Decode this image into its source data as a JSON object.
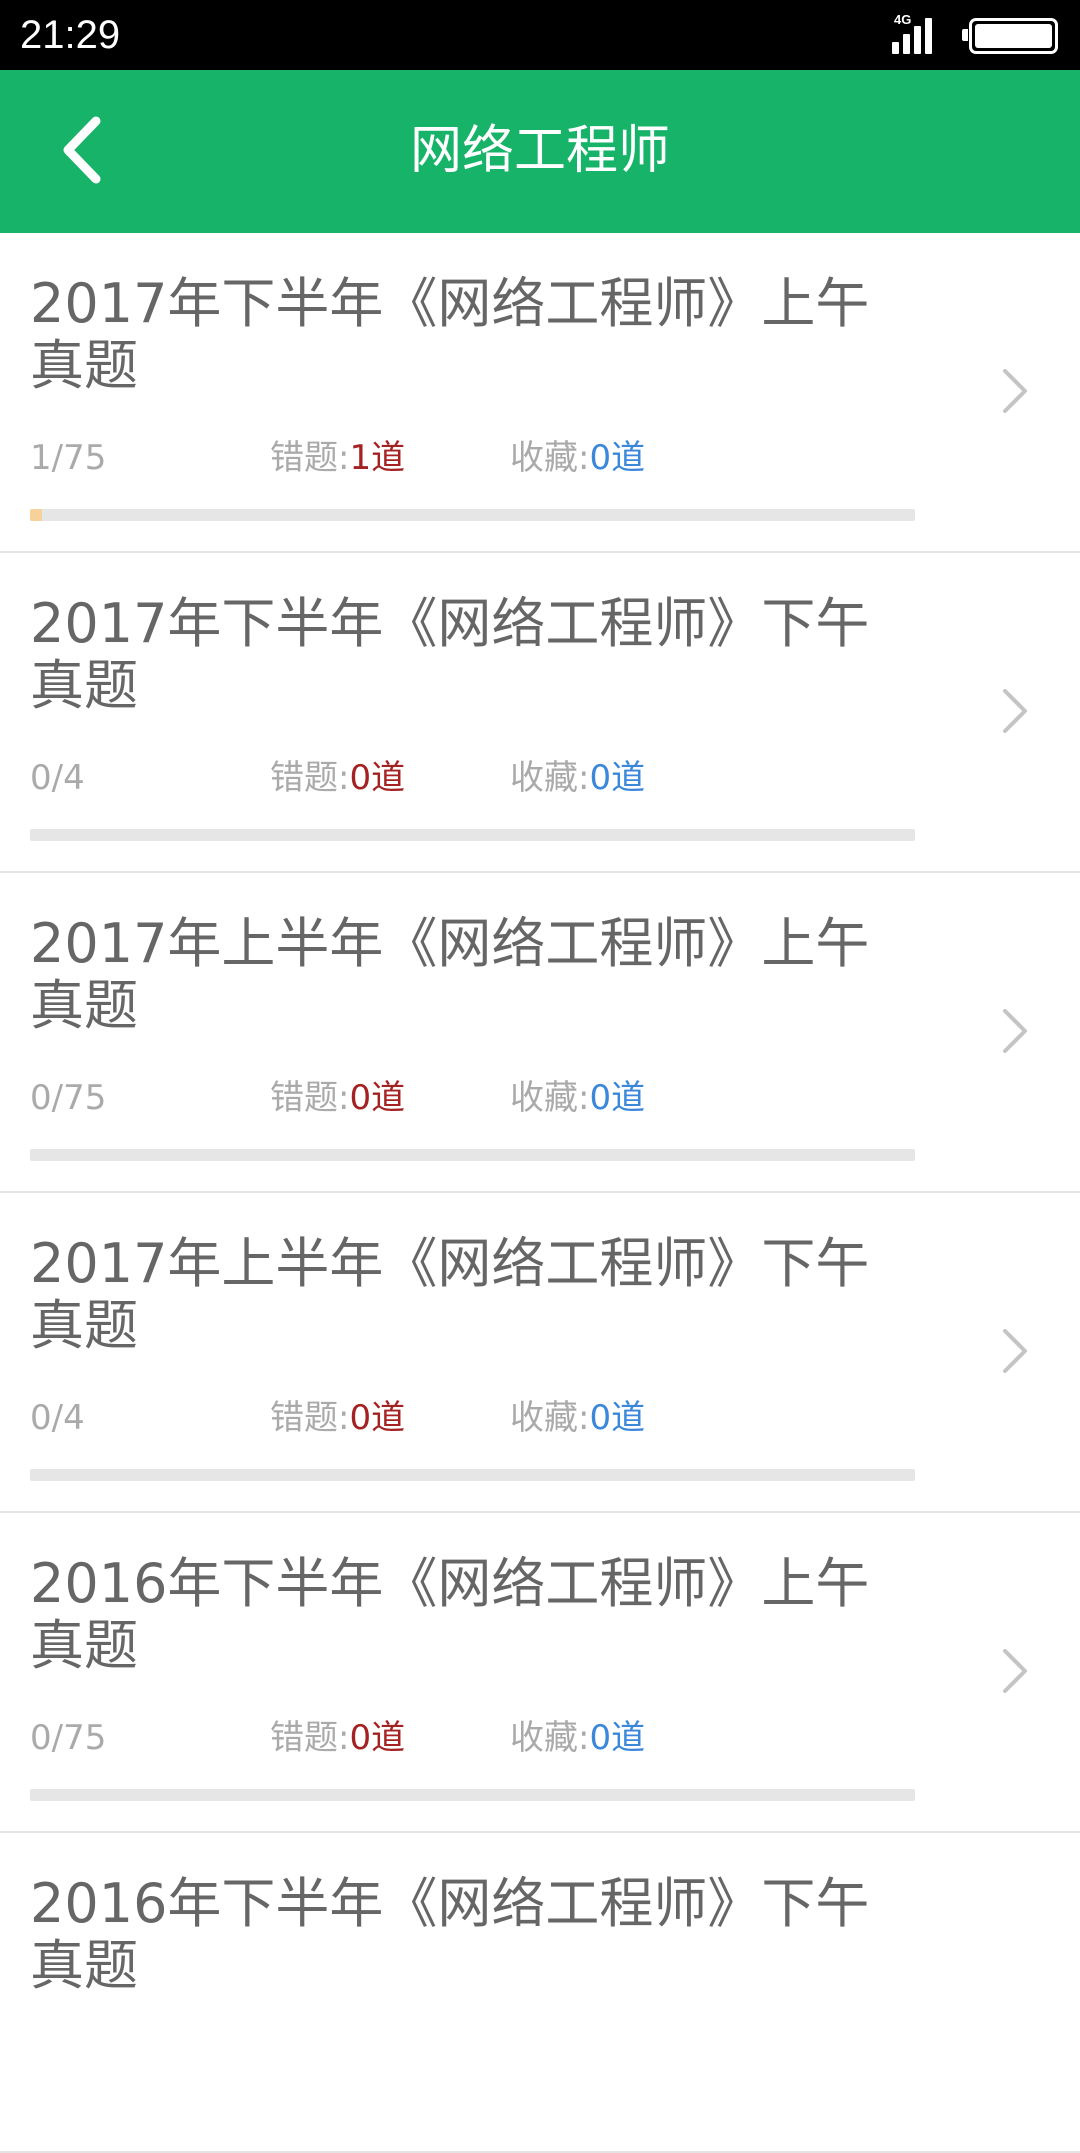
{
  "status_bar": {
    "time": "21:29",
    "network": "4G"
  },
  "app_bar": {
    "title": "网络工程师",
    "back_icon": "chevron-left-icon"
  },
  "labels": {
    "wrong": "错题:",
    "favorite": "收藏:"
  },
  "colors": {
    "accent": "#17b368",
    "wrong_count": "#a42222",
    "favorite_count": "#3b87d9",
    "progress_fill": "#f7d19b"
  },
  "exams": [
    {
      "title": "2017年下半年《网络工程师》上午真题",
      "progress_text": "1/75",
      "progress": 0.0133,
      "wrong_count": "1道",
      "favorite_count": "0道"
    },
    {
      "title": "2017年下半年《网络工程师》下午真题",
      "progress_text": "0/4",
      "progress": 0,
      "wrong_count": "0道",
      "favorite_count": "0道"
    },
    {
      "title": "2017年上半年《网络工程师》上午真题",
      "progress_text": "0/75",
      "progress": 0,
      "wrong_count": "0道",
      "favorite_count": "0道"
    },
    {
      "title": "2017年上半年《网络工程师》下午真题",
      "progress_text": "0/4",
      "progress": 0,
      "wrong_count": "0道",
      "favorite_count": "0道"
    },
    {
      "title": "2016年下半年《网络工程师》上午真题",
      "progress_text": "0/75",
      "progress": 0,
      "wrong_count": "0道",
      "favorite_count": "0道"
    },
    {
      "title": "2016年下半年《网络工程师》下午真题",
      "progress_text": "",
      "progress": 0,
      "wrong_count": "",
      "favorite_count": ""
    }
  ]
}
